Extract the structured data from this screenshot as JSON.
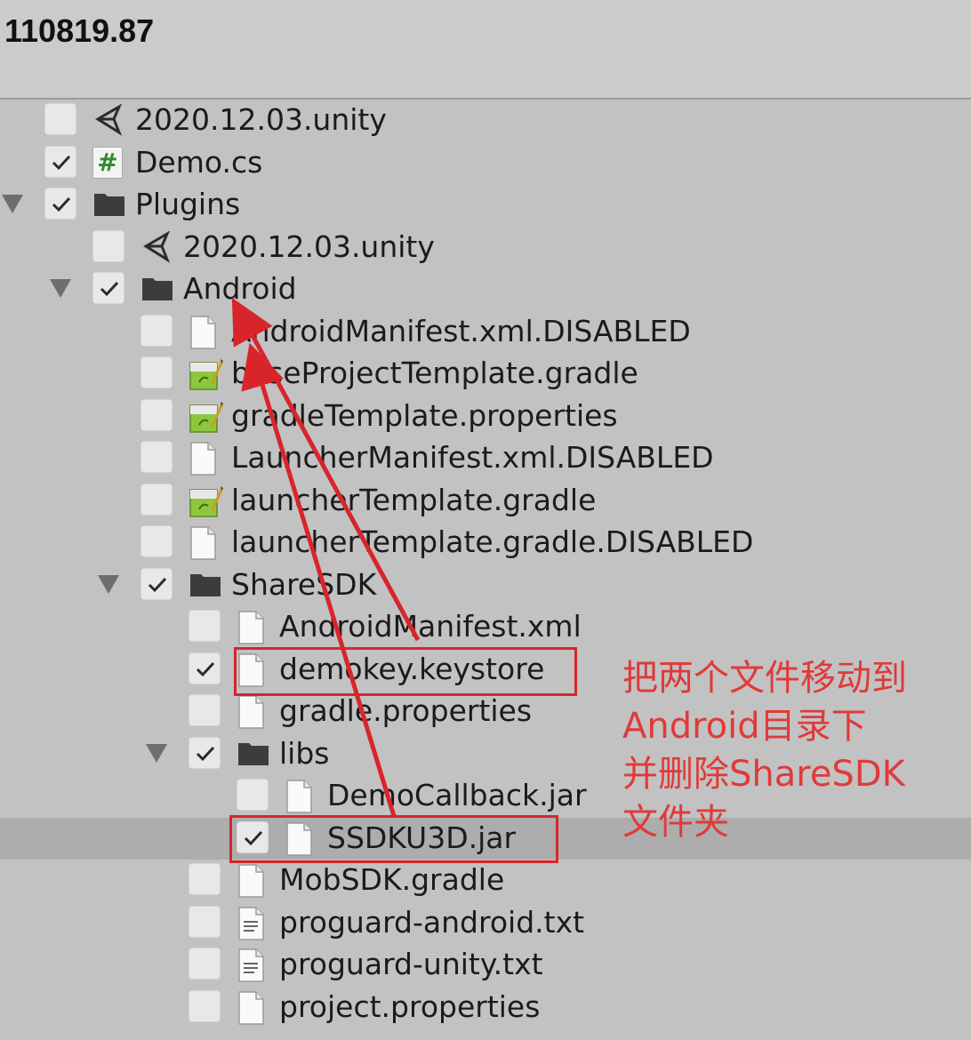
{
  "header": {
    "title": "110819.87"
  },
  "tree": [
    {
      "label": "2020.12.03.unity",
      "icon": "unity-icon",
      "checked": false,
      "depth": 0,
      "expandable": false
    },
    {
      "label": "Demo.cs",
      "icon": "csharp-script-icon",
      "checked": true,
      "depth": 0,
      "expandable": false
    },
    {
      "label": "Plugins",
      "icon": "folder-icon",
      "checked": true,
      "depth": 0,
      "expandable": true
    },
    {
      "label": "2020.12.03.unity",
      "icon": "unity-icon",
      "checked": false,
      "depth": 1,
      "expandable": false
    },
    {
      "label": "Android",
      "icon": "folder-icon",
      "checked": true,
      "depth": 1,
      "expandable": true
    },
    {
      "label": "AndroidManifest.xml.DISABLED",
      "icon": "file-icon",
      "checked": false,
      "depth": 2,
      "expandable": false
    },
    {
      "label": "baseProjectTemplate.gradle",
      "icon": "gradle-script-icon",
      "checked": false,
      "depth": 2,
      "expandable": false
    },
    {
      "label": "gradleTemplate.properties",
      "icon": "gradle-script-icon",
      "checked": false,
      "depth": 2,
      "expandable": false
    },
    {
      "label": "LauncherManifest.xml.DISABLED",
      "icon": "file-icon",
      "checked": false,
      "depth": 2,
      "expandable": false
    },
    {
      "label": "launcherTemplate.gradle",
      "icon": "gradle-script-icon",
      "checked": false,
      "depth": 2,
      "expandable": false
    },
    {
      "label": "launcherTemplate.gradle.DISABLED",
      "icon": "file-icon",
      "checked": false,
      "depth": 2,
      "expandable": false
    },
    {
      "label": "ShareSDK",
      "icon": "folder-icon",
      "checked": true,
      "depth": 2,
      "expandable": true
    },
    {
      "label": "AndroidManifest.xml",
      "icon": "file-icon",
      "checked": false,
      "depth": 3,
      "expandable": false
    },
    {
      "label": "demokey.keystore",
      "icon": "file-icon",
      "checked": true,
      "depth": 3,
      "expandable": false
    },
    {
      "label": "gradle.properties",
      "icon": "file-icon",
      "checked": false,
      "depth": 3,
      "expandable": false
    },
    {
      "label": "libs",
      "icon": "folder-icon",
      "checked": true,
      "depth": 3,
      "expandable": true
    },
    {
      "label": "DemoCallback.jar",
      "icon": "file-icon",
      "checked": false,
      "depth": 4,
      "expandable": false
    },
    {
      "label": "SSDKU3D.jar",
      "icon": "file-icon",
      "checked": true,
      "depth": 4,
      "expandable": false,
      "selected": true
    },
    {
      "label": "MobSDK.gradle",
      "icon": "file-icon",
      "checked": false,
      "depth": 3,
      "expandable": false
    },
    {
      "label": "proguard-android.txt",
      "icon": "text-file-icon",
      "checked": false,
      "depth": 3,
      "expandable": false
    },
    {
      "label": "proguard-unity.txt",
      "icon": "text-file-icon",
      "checked": false,
      "depth": 3,
      "expandable": false
    },
    {
      "label": "project.properties",
      "icon": "file-icon",
      "checked": false,
      "depth": 3,
      "expandable": false
    }
  ],
  "annotation": {
    "lines": [
      "把两个文件移动到",
      "Android目录下",
      "并删除ShareSDK",
      "文件夹"
    ],
    "color": "#e03a3a",
    "box_color": "#d8252b"
  },
  "colors": {
    "background": "#c2c2c2",
    "selected_row": "#adadad",
    "checkbox": "#e8e8e8"
  }
}
